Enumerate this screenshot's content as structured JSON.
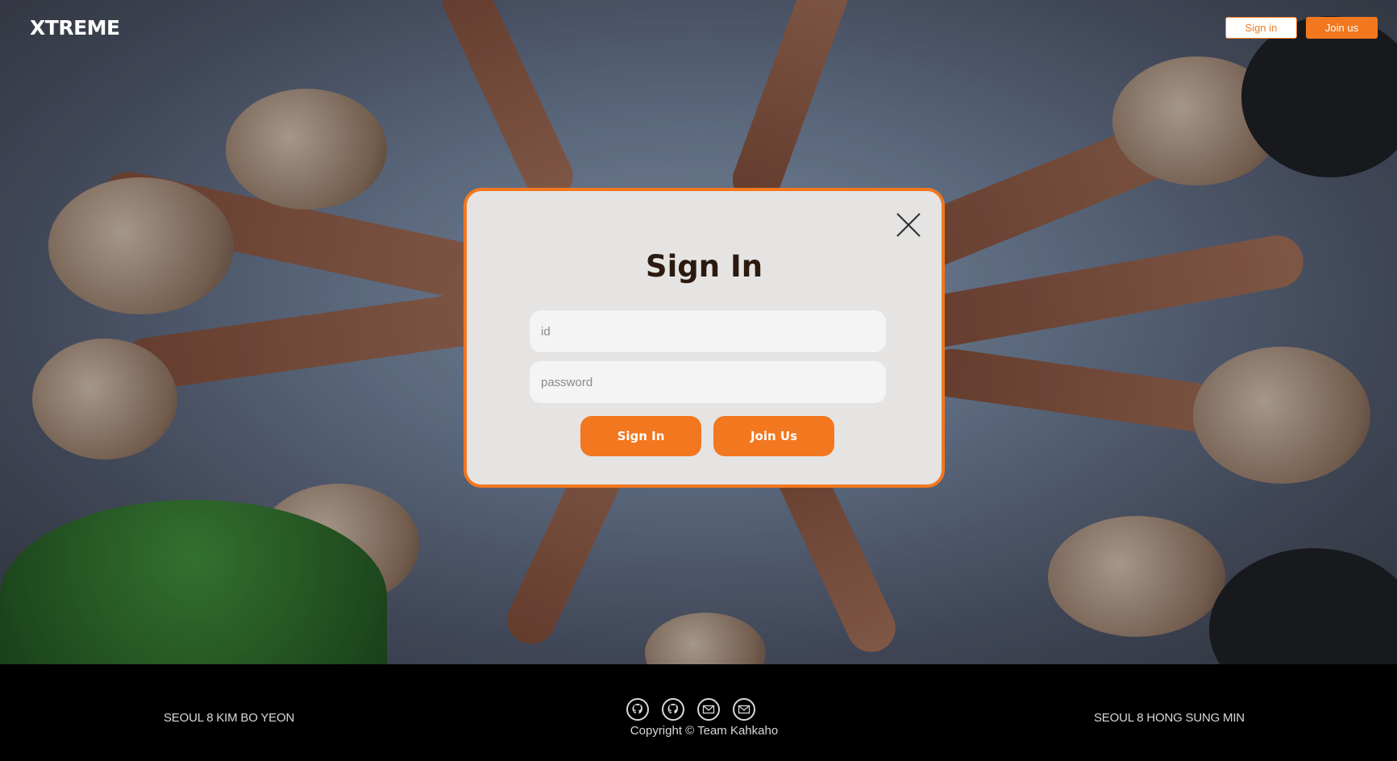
{
  "header": {
    "logo": "XTREME",
    "signin_label": "Sign in",
    "join_label": "Join us"
  },
  "modal": {
    "title": "Sign In",
    "id_placeholder": "id",
    "password_placeholder": "password",
    "signin_button": "Sign In",
    "join_button": "Join Us"
  },
  "footer": {
    "left_text": "SEOUL 8 KIM BO YEON",
    "right_text": "SEOUL 8 HONG SUNG MIN",
    "copyright": "Copyright © Team Kahkaho",
    "icons": [
      "github-icon",
      "github-icon",
      "email-icon",
      "email-icon"
    ]
  },
  "colors": {
    "accent": "#f2771f",
    "modal_bg": "#e5e4e3",
    "footer_bg": "#000000"
  }
}
